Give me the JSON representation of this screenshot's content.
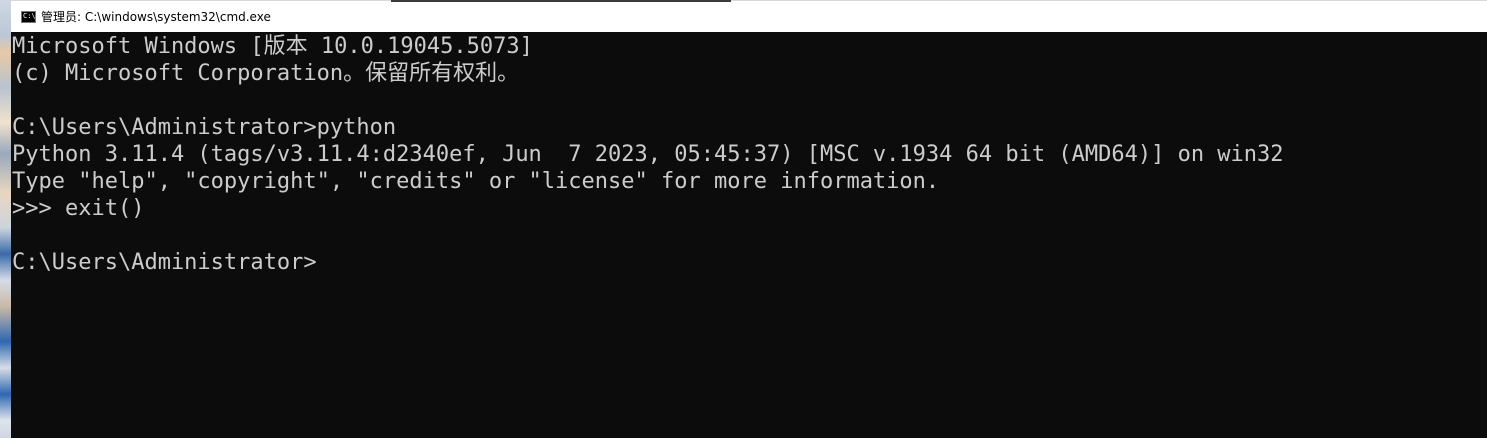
{
  "window": {
    "title": "管理员: C:\\windows\\system32\\cmd.exe",
    "icon": "console-icon"
  },
  "console": {
    "lines": [
      "Microsoft Windows [版本 10.0.19045.5073]",
      "(c) Microsoft Corporation。保留所有权利。",
      "",
      "C:\\Users\\Administrator>python",
      "Python 3.11.4 (tags/v3.11.4:d2340ef, Jun  7 2023, 05:45:37) [MSC v.1934 64 bit (AMD64)] on win32",
      "Type \"help\", \"copyright\", \"credits\" or \"license\" for more information.",
      ">>> exit()",
      "",
      "C:\\Users\\Administrator>"
    ]
  },
  "colors": {
    "console_bg": "#0c0c0c",
    "console_text": "#cccccc",
    "titlebar_bg": "#ffffff"
  }
}
